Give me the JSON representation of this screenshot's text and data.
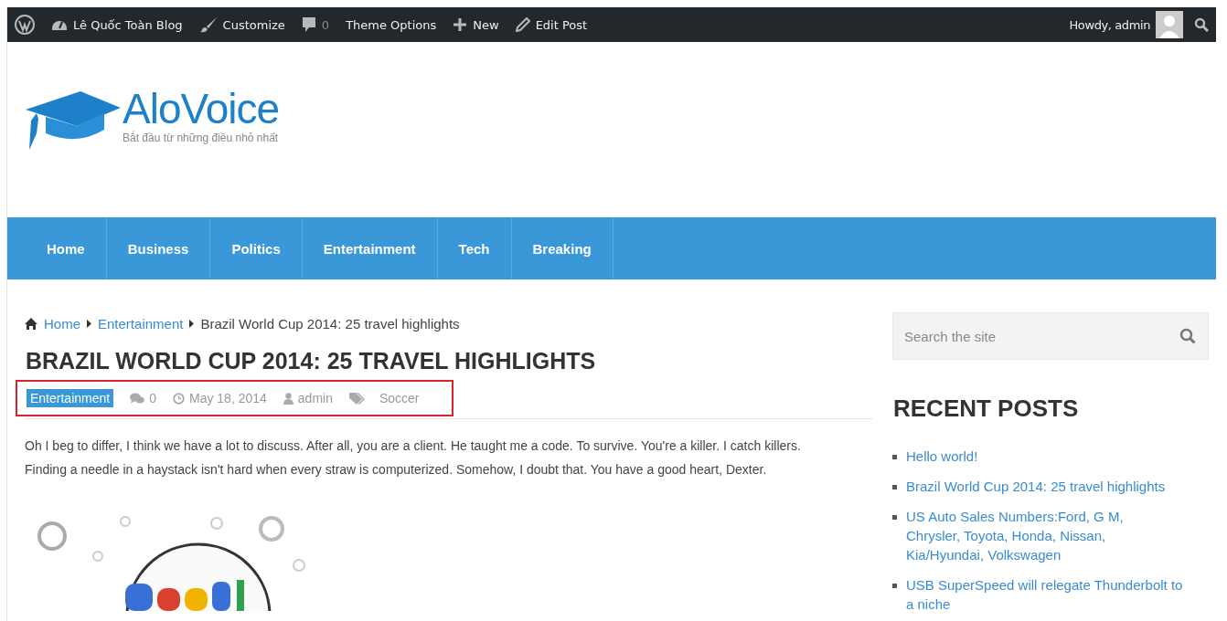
{
  "admin_bar": {
    "items": [
      {
        "kind": "logo"
      },
      {
        "kind": "site",
        "label": "Lê Quốc Toàn Blog"
      },
      {
        "kind": "customize",
        "label": "Customize"
      },
      {
        "kind": "comments",
        "label": "0"
      },
      {
        "kind": "plain",
        "label": "Theme Options"
      },
      {
        "kind": "new",
        "label": "New"
      },
      {
        "kind": "edit",
        "label": "Edit Post"
      }
    ],
    "greeting": "Howdy, admin"
  },
  "header": {
    "logo_name": "AloVoice",
    "tagline": "Bắt đầu từ những điều nhỏ nhất"
  },
  "nav": [
    {
      "label": "Home"
    },
    {
      "label": "Business"
    },
    {
      "label": "Politics"
    },
    {
      "label": "Entertainment"
    },
    {
      "label": "Tech"
    },
    {
      "label": "Breaking"
    }
  ],
  "breadcrumb": [
    {
      "label": "Home",
      "link": true
    },
    {
      "label": "Entertainment",
      "link": true
    },
    {
      "label": "Brazil World Cup 2014: 25 travel highlights",
      "link": false
    }
  ],
  "post": {
    "title": "BRAZIL WORLD CUP 2014: 25 TRAVEL HIGHLIGHTS",
    "meta": {
      "highlighted": true,
      "category": "Entertainment",
      "comments": "0",
      "date": "May 18, 2014",
      "author": "admin",
      "tag": "Soccer"
    },
    "body": "Oh I beg to differ, I think we have a lot to discuss. After all, you are a client. He taught me a code. To survive. You're a killer. I catch killers. Finding a needle in a haystack isn't hard when every straw is computerized. Somehow, I doubt that. You have a good heart, Dexter."
  },
  "sidebar": {
    "search": {
      "placeholder": "Search the site"
    },
    "recent_title": "RECENT POSTS",
    "recent_posts": [
      "Hello world!",
      "Brazil World Cup 2014: 25 travel highlights",
      "US Auto Sales Numbers:Ford, G M, Chrysler, Toyota, Honda, Nissan, Kia/Hyundai, Volkswagen",
      "USB SuperSpeed will relegate Thunderbolt to a niche"
    ]
  }
}
